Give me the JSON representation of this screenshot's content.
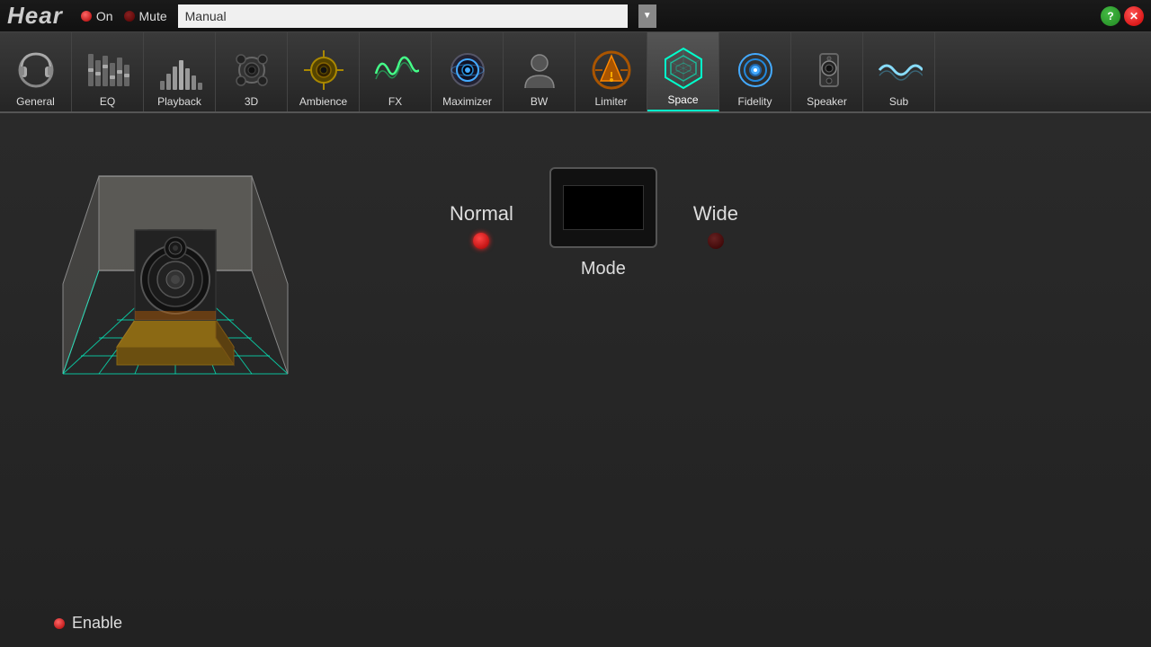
{
  "header": {
    "title": "Hear",
    "on_label": "On",
    "mute_label": "Mute",
    "manual_value": "Manual",
    "dropdown_placeholder": "Manual"
  },
  "tabs": [
    {
      "id": "general",
      "label": "General",
      "icon": "🎧",
      "active": false
    },
    {
      "id": "eq",
      "label": "EQ",
      "icon": "🎚",
      "active": false
    },
    {
      "id": "playback",
      "label": "Playback",
      "icon": "📊",
      "active": false
    },
    {
      "id": "3d",
      "label": "3D",
      "icon": "🔊",
      "active": false
    },
    {
      "id": "ambience",
      "label": "Ambience",
      "icon": "⚙",
      "active": false
    },
    {
      "id": "fx",
      "label": "FX",
      "icon": "〰",
      "active": false
    },
    {
      "id": "maximizer",
      "label": "Maximizer",
      "icon": "🎧",
      "active": false
    },
    {
      "id": "bw",
      "label": "BW",
      "icon": "👤",
      "active": false
    },
    {
      "id": "limiter",
      "label": "Limiter",
      "icon": "🎛",
      "active": false
    },
    {
      "id": "space",
      "label": "Space",
      "icon": "⬡",
      "active": true
    },
    {
      "id": "fidelity",
      "label": "Fidelity",
      "icon": "◎",
      "active": false
    },
    {
      "id": "speaker",
      "label": "Speaker",
      "icon": "🎞",
      "active": false
    },
    {
      "id": "sub",
      "label": "Sub",
      "icon": "〜",
      "active": false
    }
  ],
  "space": {
    "mode_normal_label": "Normal",
    "mode_wide_label": "Wide",
    "mode_label": "Mode",
    "normal_active": true,
    "wide_active": false
  },
  "enable": {
    "label": "Enable"
  },
  "buttons": {
    "help": "?",
    "close": "✕"
  }
}
